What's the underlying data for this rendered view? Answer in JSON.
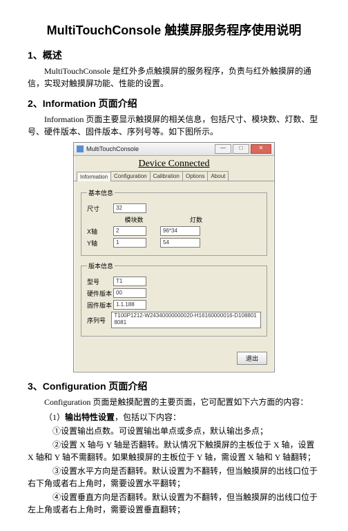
{
  "doc": {
    "title": "MultiTouchConsole 触摸屏服务程序使用说明",
    "s1_heading": "1、概述",
    "s1_body": "MultiTouchConsole 是红外多点触摸屏的服务程序，负责与红外触摸屏的通信，实现对触摸屏功能、性能的设置。",
    "s2_heading": "2、Information 页面介绍",
    "s2_body": "Information 页面主要显示触摸屏的相关信息，包括尺寸、模块数、灯数、型号、硬件版本、固件版本、序列号等。如下图所示。",
    "s3_heading": "3、Configuration 页面介绍",
    "s3_lead": "Configuration 页面是触摸配置的主要页面，它可配置如下六方面的内容：",
    "s3_item1": "（1）输出特性设置，包括以下内容：",
    "s3_item1_1": "①设置输出点数。可设置输出单点或多点，默认输出多点；",
    "s3_item1_2": "②设置 X 轴与 Y 轴是否翻转。默认情况下触摸屏的主板位于 X 轴，设置 X 轴和 Y 轴不需翻转。如果触摸屏的主板位于 Y 轴，需设置 X 轴和 Y 轴翻转；",
    "s3_item1_3": "③设置水平方向是否翻转。默认设置为不翻转，但当触摸屏的出线口位于右下角或者右上角时，需要设置水平翻转；",
    "s3_item1_4": "④设置垂直方向是否翻转。默认设置为不翻转，但当触摸屏的出线口位于左上角或者右上角时，需要设置垂直翻转；"
  },
  "win": {
    "title": "MultiTouchConsole",
    "banner": "Device Connected",
    "tabs": [
      "Information",
      "Configuration",
      "Calibration",
      "Options",
      "About"
    ],
    "group_basic": "基本信息",
    "group_version": "版本信息",
    "label_size": "尺寸",
    "value_size": "32",
    "col_modules": "模块数",
    "col_lights": "灯数",
    "label_xaxis": "X轴",
    "value_xmods": "2",
    "value_xlights": "96*34",
    "label_yaxis": "Y轴",
    "value_ymods": "1",
    "value_ylights": "54",
    "label_model": "型号",
    "value_model": "T1",
    "label_hw": "硬件版本",
    "value_hw": "00",
    "label_fw": "固件版本",
    "value_fw": "1.1.188",
    "label_serial": "序列号",
    "value_serial": "T100P1212-W24340000000020-H16160000016-D1088018081",
    "btn_exit": "退出"
  }
}
